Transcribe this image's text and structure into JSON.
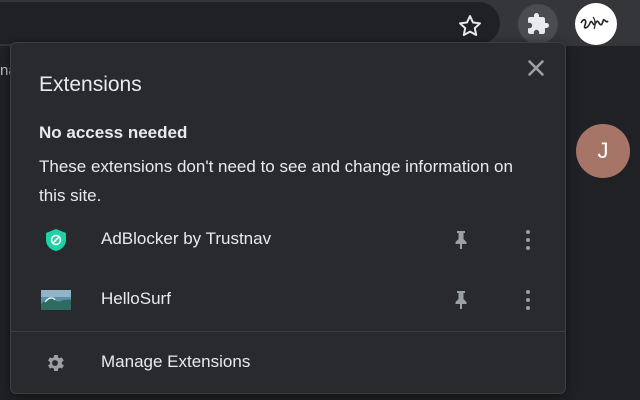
{
  "colors": {
    "popup_bg": "#292a2d",
    "text": "#e8eaed",
    "icon": "#9aa0a6",
    "adblocker_shield": "#1fd1a6",
    "page_avatar": "#a67567"
  },
  "toolbar": {
    "star_icon": "star-icon",
    "extensions_icon": "puzzle-icon",
    "left_fragment": "na"
  },
  "page": {
    "avatar_initial": "J"
  },
  "popup": {
    "title": "Extensions",
    "close_icon": "close-icon",
    "section_heading": "No access needed",
    "section_description": "These extensions don't need to see and change information on this site.",
    "extensions": [
      {
        "name": "AdBlocker by Trustnav",
        "icon": "shield-icon",
        "pin_icon": "pin-icon",
        "more_icon": "more-vert-icon"
      },
      {
        "name": "HelloSurf",
        "icon": "wave-thumbnail-icon",
        "pin_icon": "pin-icon",
        "more_icon": "more-vert-icon"
      }
    ],
    "manage_label": "Manage Extensions",
    "manage_icon": "gear-icon"
  }
}
